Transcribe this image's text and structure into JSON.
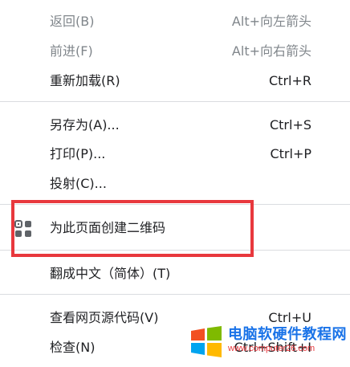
{
  "menu": {
    "items": [
      {
        "label": "返回(B)",
        "shortcut": "Alt+向左箭头",
        "disabled": true
      },
      {
        "label": "前进(F)",
        "shortcut": "Alt+向右箭头",
        "disabled": true
      },
      {
        "label": "重新加载(R)",
        "shortcut": "Ctrl+R"
      },
      {
        "label": "另存为(A)...",
        "shortcut": "Ctrl+S"
      },
      {
        "label": "打印(P)...",
        "shortcut": "Ctrl+P"
      },
      {
        "label": "投射(C)..."
      },
      {
        "label": "为此页面创建二维码",
        "icon": "qr-code-icon"
      },
      {
        "label": "翻成中文（简体）(T)"
      },
      {
        "label": "查看网页源代码(V)",
        "shortcut": "Ctrl+U"
      },
      {
        "label": "检查(N)",
        "shortcut": "Ctrl+Shift+I"
      }
    ]
  },
  "highlight_color": "#e8383d",
  "watermark": {
    "title": "电脑软硬件教程网",
    "url": "www.computer26.com"
  }
}
